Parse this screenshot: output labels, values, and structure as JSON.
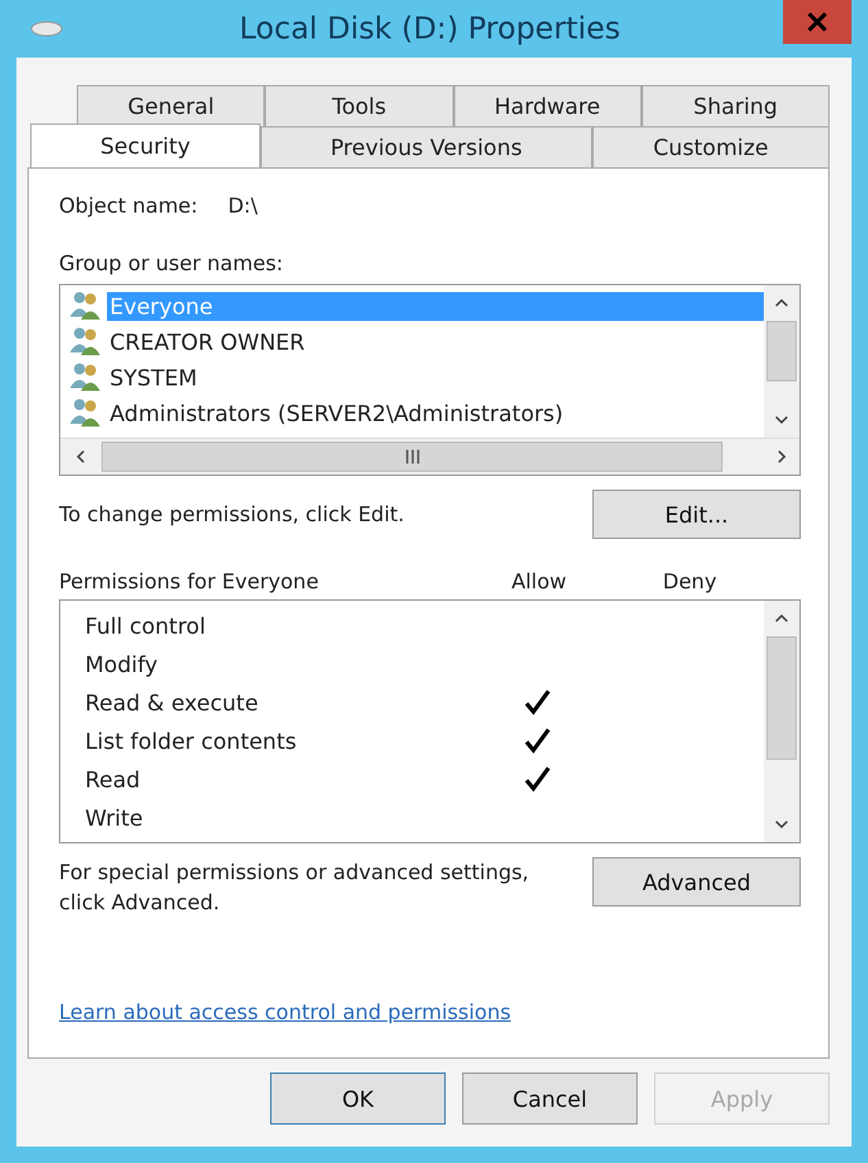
{
  "window": {
    "title": "Local Disk (D:) Properties"
  },
  "tab_rows": [
    [
      {
        "label": "General",
        "selected": false
      },
      {
        "label": "Tools",
        "selected": false
      },
      {
        "label": "Hardware",
        "selected": false
      },
      {
        "label": "Sharing",
        "selected": false
      }
    ],
    [
      {
        "label": "Security",
        "selected": true
      },
      {
        "label": "Previous Versions",
        "selected": false
      },
      {
        "label": "Customize",
        "selected": false
      }
    ]
  ],
  "object_name": {
    "label": "Object name:",
    "value": "D:\\"
  },
  "groups": {
    "label": "Group or user names:",
    "items": [
      {
        "name": "Everyone",
        "selected": true
      },
      {
        "name": "CREATOR OWNER",
        "selected": false
      },
      {
        "name": "SYSTEM",
        "selected": false
      },
      {
        "name": "Administrators (SERVER2\\Administrators)",
        "selected": false
      }
    ]
  },
  "edit_hint": "To change permissions, click Edit.",
  "edit_button": "Edit...",
  "permissions": {
    "label": "Permissions for Everyone",
    "allow_label": "Allow",
    "deny_label": "Deny",
    "items": [
      {
        "name": "Full control",
        "allow": false,
        "deny": false
      },
      {
        "name": "Modify",
        "allow": false,
        "deny": false
      },
      {
        "name": "Read & execute",
        "allow": true,
        "deny": false
      },
      {
        "name": "List folder contents",
        "allow": true,
        "deny": false
      },
      {
        "name": "Read",
        "allow": true,
        "deny": false
      },
      {
        "name": "Write",
        "allow": false,
        "deny": false
      }
    ]
  },
  "advanced_hint": "For special permissions or advanced settings, click Advanced.",
  "advanced_button": "Advanced",
  "link": "Learn about access control and permissions",
  "buttons": [
    {
      "label": "OK",
      "disabled": false
    },
    {
      "label": "Cancel",
      "disabled": false
    },
    {
      "label": "Apply",
      "disabled": true
    }
  ]
}
